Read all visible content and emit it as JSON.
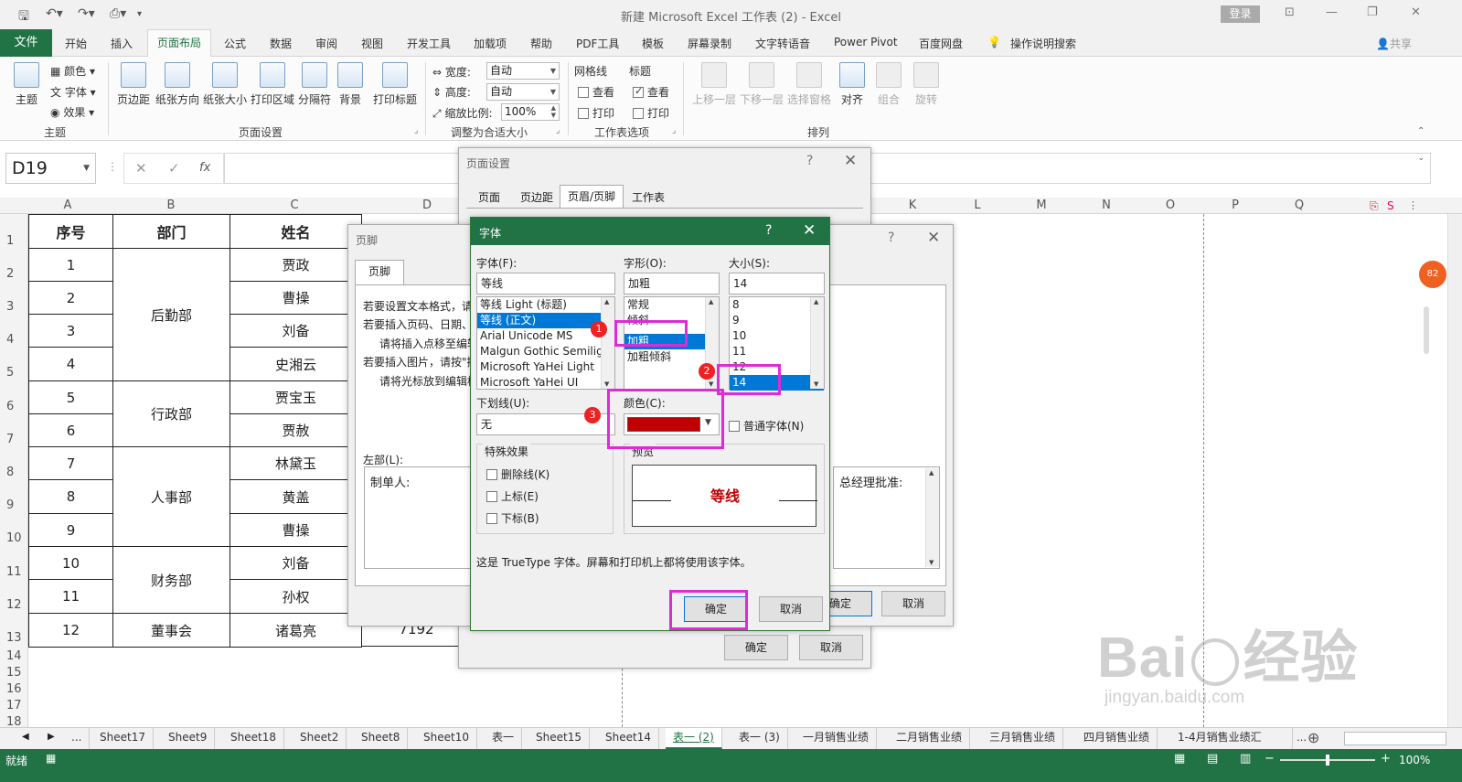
{
  "window": {
    "title": "新建 Microsoft Excel 工作表 (2)  -  Excel",
    "login": "登录",
    "share": "共享"
  },
  "ribbon_tabs": {
    "file": "文件",
    "tabs": [
      "开始",
      "插入",
      "页面布局",
      "公式",
      "数据",
      "审阅",
      "视图",
      "开发工具",
      "加载项",
      "帮助",
      "PDF工具",
      "模板",
      "屏幕录制",
      "文字转语音",
      "Power Pivot",
      "百度网盘",
      "操作说明搜索"
    ],
    "active_index": 2
  },
  "ribbon": {
    "theme": {
      "main": "主题",
      "colors": "颜色",
      "fonts": "字体",
      "effects": "效果",
      "group": "主题"
    },
    "page_setup": {
      "buttons": [
        "页边距",
        "纸张方向",
        "纸张大小",
        "打印区域",
        "分隔符",
        "背景",
        "打印标题"
      ],
      "group": "页面设置"
    },
    "scale": {
      "width_label": "宽度:",
      "width_value": "自动",
      "height_label": "高度:",
      "height_value": "自动",
      "scale_label": "缩放比例:",
      "scale_value": "100%",
      "group": "调整为合适大小"
    },
    "sheet_options": {
      "gridlines": "网格线",
      "headings": "标题",
      "view": "查看",
      "print": "打印",
      "group": "工作表选项"
    },
    "arrange": {
      "buttons": [
        "上移一层",
        "下移一层",
        "选择窗格",
        "对齐",
        "组合",
        "旋转"
      ],
      "group": "排列"
    }
  },
  "formula_bar": {
    "name_box": "D19",
    "fx": "fx",
    "cancel": "✕",
    "enter": "✓"
  },
  "columns": [
    "A",
    "B",
    "C",
    "D",
    "K",
    "L",
    "M",
    "N",
    "O",
    "P",
    "Q"
  ],
  "rows": [
    "1",
    "2",
    "3",
    "4",
    "5",
    "6",
    "7",
    "8",
    "9",
    "10",
    "11",
    "12",
    "13",
    "14",
    "15",
    "16",
    "17",
    "18"
  ],
  "table": {
    "headers": [
      "序号",
      "部门",
      "姓名"
    ],
    "numbers": [
      "1",
      "2",
      "3",
      "4",
      "5",
      "6",
      "7",
      "8",
      "9",
      "10",
      "11",
      "12"
    ],
    "departments": [
      "后勤部",
      "行政部",
      "人事部",
      "财务部",
      "董事会"
    ],
    "names": [
      "贾政",
      "曹操",
      "刘备",
      "史湘云",
      "贾宝玉",
      "贾赦",
      "林黛玉",
      "黄盖",
      "曹操",
      "刘备",
      "孙权",
      "诸葛亮"
    ],
    "d13": "7192"
  },
  "page_setup_dialog": {
    "title": "页面设置",
    "tabs": [
      "页面",
      "页边距",
      "页眉/页脚",
      "工作表"
    ],
    "ok": "确定",
    "cancel": "取消"
  },
  "footer_dialog": {
    "title": "页脚",
    "tab": "页脚",
    "instructions": [
      "若要设置文本格式，请",
      "若要插入页码、日期、",
      "请将插入点移至编辑",
      "若要插入图片，请按\"插",
      "请将光标放到编辑框"
    ],
    "left_label": "左部(L):",
    "left_text": "制单人:",
    "right_text": "总经理批准:",
    "ok": "确定",
    "cancel": "取消"
  },
  "font_dialog": {
    "title": "字体",
    "help": "?",
    "font_label": "字体(F):",
    "font_value": "等线",
    "font_list": [
      "等线 Light (标题)",
      "等线 (正文)",
      "Arial Unicode MS",
      "Malgun Gothic Semilig",
      "Microsoft YaHei Light",
      "Microsoft YaHei UI"
    ],
    "style_label": "字形(O):",
    "style_value": "加粗",
    "style_list": [
      "常规",
      "倾斜",
      "加粗",
      "加粗倾斜"
    ],
    "size_label": "大小(S):",
    "size_value": "14",
    "size_list": [
      "8",
      "9",
      "10",
      "11",
      "12",
      "14"
    ],
    "underline_label": "下划线(U):",
    "underline_value": "无",
    "color_label": "颜色(C):",
    "color_value": "#c00000",
    "normal_font": "普通字体(N)",
    "effects_label": "特殊效果",
    "strikethrough": "删除线(K)",
    "superscript": "上标(E)",
    "subscript": "下标(B)",
    "preview_label": "预览",
    "preview_text": "等线",
    "note": "这是 TrueType 字体。屏幕和打印机上都将使用该字体。",
    "ok": "确定",
    "cancel": "取消",
    "annotations": [
      "1",
      "2",
      "3"
    ]
  },
  "sheet_tabs": [
    "...",
    "Sheet17",
    "Sheet9",
    "Sheet18",
    "Sheet2",
    "Sheet8",
    "Sheet10",
    "表一",
    "Sheet15",
    "Sheet14",
    "表一 (2)",
    "表一 (3)",
    "一月销售业绩",
    "二月销售业绩",
    "三月销售业绩",
    "四月销售业绩",
    "1-4月销售业绩汇"
  ],
  "active_sheet_index": 10,
  "status": {
    "ready": "就绪",
    "zoom": "100%"
  },
  "watermark": {
    "brand": "Bai",
    "brand2": "经验",
    "url": "jingyan.baidu.com"
  },
  "colors": {
    "excel_green": "#217346",
    "selection": "#0078d7",
    "annotation": "#e02ad8",
    "badge": "#e22222"
  }
}
